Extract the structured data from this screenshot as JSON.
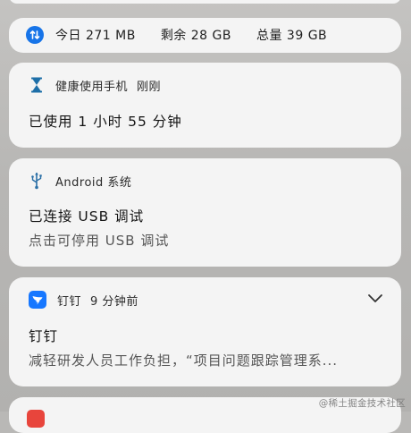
{
  "data_usage": {
    "icon": "data-transfer-icon",
    "accent": "#1774e8",
    "today": "今日 271 MB",
    "remaining": "剩余 28 GB",
    "total": "总量 39 GB"
  },
  "health": {
    "icon": "hourglass-icon",
    "app_name": "健康使用手机",
    "time": "刚刚",
    "title": "已使用 1 小时 55 分钟"
  },
  "usb": {
    "icon": "usb-icon",
    "app_name": "Android 系统",
    "title": "已连接 USB 调试",
    "body": "点击可停用 USB 调试"
  },
  "dingtalk": {
    "icon": "dingtalk-icon",
    "accent": "#1677ff",
    "app_name": "钉钉",
    "time": "9 分钟前",
    "title": "钉钉",
    "body": "减轻研发人员工作负担，“项目问题跟踪管理系..."
  },
  "watermark": "@稀土掘金技术社区"
}
